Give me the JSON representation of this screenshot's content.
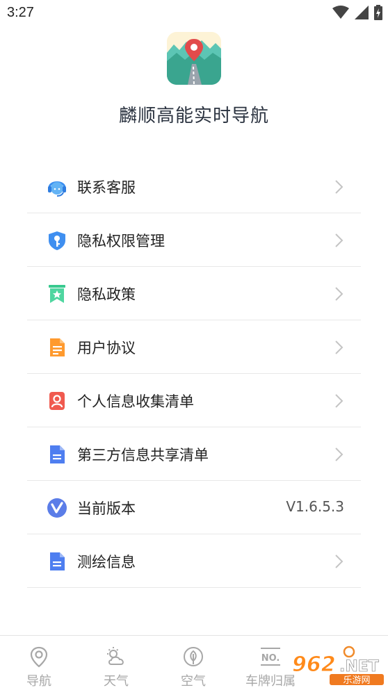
{
  "status": {
    "time": "3:27"
  },
  "app": {
    "title": "麟顺高能实时导航"
  },
  "menu": [
    {
      "label": "联系客服",
      "icon": "customer-service-icon"
    },
    {
      "label": "隐私权限管理",
      "icon": "shield-key-icon"
    },
    {
      "label": "隐私政策",
      "icon": "bookmark-star-icon"
    },
    {
      "label": "用户协议",
      "icon": "document-icon"
    },
    {
      "label": "个人信息收集清单",
      "icon": "person-doc-icon"
    },
    {
      "label": "第三方信息共享清单",
      "icon": "list-doc-icon"
    },
    {
      "label": "当前版本",
      "icon": "version-v-icon",
      "value": "V1.6.5.3"
    },
    {
      "label": "测绘信息",
      "icon": "list-doc-icon"
    }
  ],
  "tabs": [
    {
      "label": "导航",
      "icon": "location-pin-icon"
    },
    {
      "label": "天气",
      "icon": "weather-icon"
    },
    {
      "label": "空气",
      "icon": "leaf-icon"
    },
    {
      "label": "车牌归属",
      "icon": "license-plate-icon"
    }
  ],
  "watermark": {
    "text": "962.NET",
    "subtext": "乐游网"
  },
  "colors": {
    "accent": "#4a8ff0",
    "tab_inactive": "#a7a7a7",
    "divider": "#e8e8e8"
  }
}
